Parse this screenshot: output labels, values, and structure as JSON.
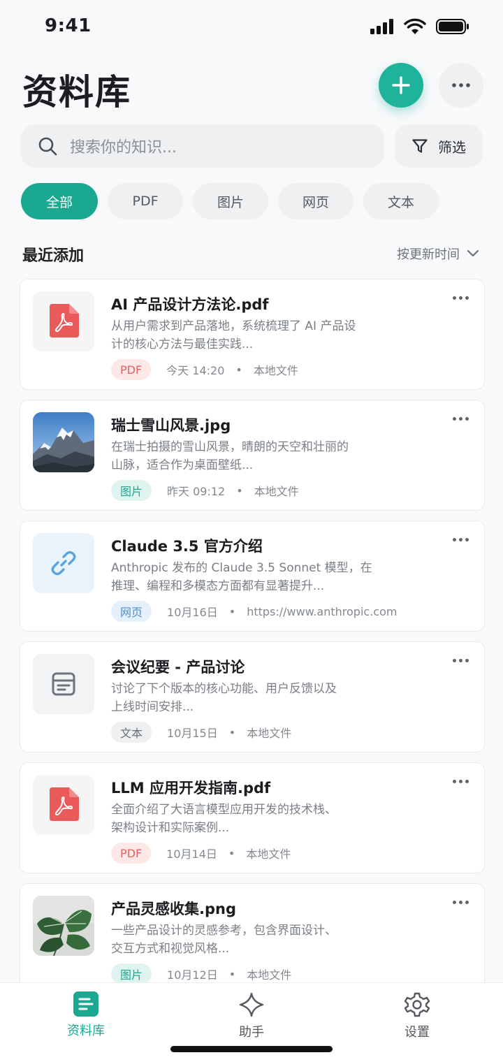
{
  "status": {
    "time": "9:41"
  },
  "header": {
    "title": "资料库"
  },
  "search": {
    "placeholder": "搜索你的知识..."
  },
  "filter": {
    "label": "筛选"
  },
  "chips": [
    "全部",
    "PDF",
    "图片",
    "网页",
    "文本"
  ],
  "section": {
    "title": "最近添加",
    "sort_label": "按更新时间"
  },
  "items": [
    {
      "title": "AI 产品设计方法论.pdf",
      "desc_line1": "从用户需求到产品落地，系统梳理了 AI 产品设",
      "desc_line2": "计的核心方法与最佳实践...",
      "tag": "PDF",
      "date": "今天 14:20",
      "source": "本地文件",
      "icon": "pdf-icon"
    },
    {
      "title": "瑞士雪山风景.jpg",
      "desc_line1": "在瑞士拍摄的雪山风景，晴朗的天空和壮丽的",
      "desc_line2": "山脉，适合作为桌面壁纸...",
      "tag": "图片",
      "date": "昨天 09:12",
      "source": "本地文件",
      "icon": "mountain-thumbnail"
    },
    {
      "title": "Claude 3.5 官方介绍",
      "desc_line1": "Anthropic 发布的 Claude 3.5 Sonnet 模型，在",
      "desc_line2": "推理、编程和多模态方面都有显著提升...",
      "tag": "网页",
      "date": "10月16日",
      "source": "https://www.anthropic.com",
      "icon": "link-icon"
    },
    {
      "title": "会议纪要 - 产品讨论",
      "desc_line1": "讨论了下个版本的核心功能、用户反馈以及",
      "desc_line2": "上线时间安排...",
      "tag": "文本",
      "date": "10月15日",
      "source": "本地文件",
      "icon": "document-icon"
    },
    {
      "title": "LLM 应用开发指南.pdf",
      "desc_line1": "全面介绍了大语言模型应用开发的技术栈、",
      "desc_line2": "架构设计和实际案例...",
      "tag": "PDF",
      "date": "10月14日",
      "source": "本地文件",
      "icon": "pdf-icon"
    },
    {
      "title": "产品灵感收集.png",
      "desc_line1": "一些产品设计的灵感参考，包含界面设计、",
      "desc_line2": "交互方式和视觉风格...",
      "tag": "图片",
      "date": "10月12日",
      "source": "本地文件",
      "icon": "plant-thumbnail"
    }
  ],
  "tabs": [
    {
      "label": "资料库",
      "icon": "library-icon",
      "active": true
    },
    {
      "label": "助手",
      "icon": "sparkle-icon",
      "active": false
    },
    {
      "label": "设置",
      "icon": "gear-icon",
      "active": false
    }
  ],
  "colors": {
    "accent": "#1ba890",
    "pdf": "#ea5a5a",
    "link": "#5aa4de"
  }
}
